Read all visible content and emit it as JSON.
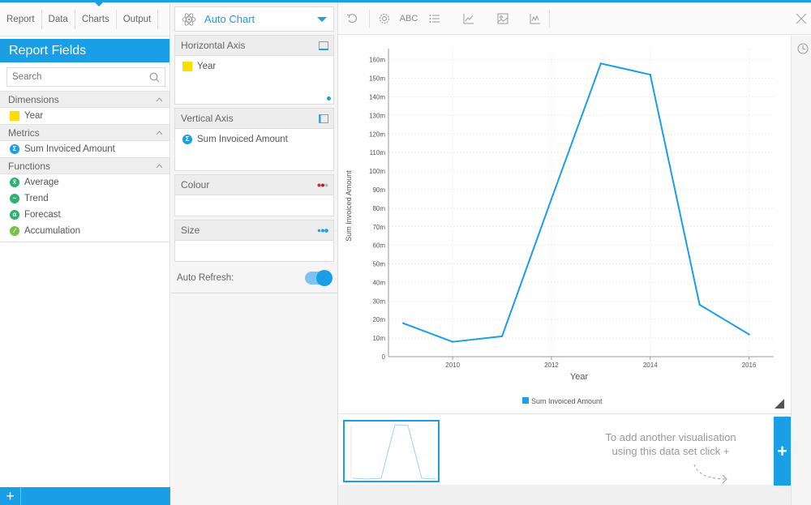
{
  "nav": {
    "tabs": [
      {
        "label": "Report"
      },
      {
        "label": "Data"
      },
      {
        "label": "Charts"
      },
      {
        "label": "Output"
      }
    ],
    "active_tab": "Charts"
  },
  "report_fields": {
    "title": "Report Fields",
    "search_placeholder": "Search",
    "dimensions": {
      "label": "Dimensions",
      "items": [
        "Year"
      ]
    },
    "metrics": {
      "label": "Metrics",
      "items": [
        "Sum Invoiced Amount"
      ]
    },
    "functions": {
      "label": "Functions",
      "items": [
        "Average",
        "Trend",
        "Forecast",
        "Accumulation"
      ]
    }
  },
  "config": {
    "chart_type": "Auto Chart",
    "horizontal_axis": {
      "label": "Horizontal Axis",
      "field": "Year"
    },
    "vertical_axis": {
      "label": "Vertical Axis",
      "field": "Sum Invoiced Amount"
    },
    "colour": {
      "label": "Colour"
    },
    "size": {
      "label": "Size"
    },
    "auto_refresh_label": "Auto Refresh:",
    "auto_refresh_on": true
  },
  "toolbar": {
    "abc_label": "ABC"
  },
  "colors": {
    "accent": "#1a9ee6",
    "dimension_swatch": "#ffdd00",
    "average": "#2db36f",
    "trend": "#2db36f",
    "forecast": "#2db36f",
    "accumulation": "#79c142"
  },
  "chart_data": {
    "type": "line",
    "xlabel": "Year",
    "ylabel": "Sum Invoiced Amount",
    "x": [
      2009,
      2010,
      2011,
      2012,
      2013,
      2014,
      2015,
      2016
    ],
    "series": [
      {
        "name": "Sum Invoiced Amount",
        "values": [
          18,
          8,
          11,
          85,
          158,
          152,
          28,
          12
        ]
      }
    ],
    "x_ticks": [
      "2010",
      "2012",
      "2014",
      "2016"
    ],
    "y_ticks": [
      "0",
      "10m",
      "20m",
      "30m",
      "40m",
      "50m",
      "60m",
      "70m",
      "80m",
      "90m",
      "100m",
      "110m",
      "120m",
      "130m",
      "140m",
      "150m",
      "160m"
    ],
    "ylim": [
      0,
      160
    ],
    "y_unit": "m",
    "grid": true,
    "legend_position": "bottom"
  },
  "hint": {
    "line1": "To add another visualisation",
    "line2": "using this data set click +"
  },
  "add_label": "+"
}
